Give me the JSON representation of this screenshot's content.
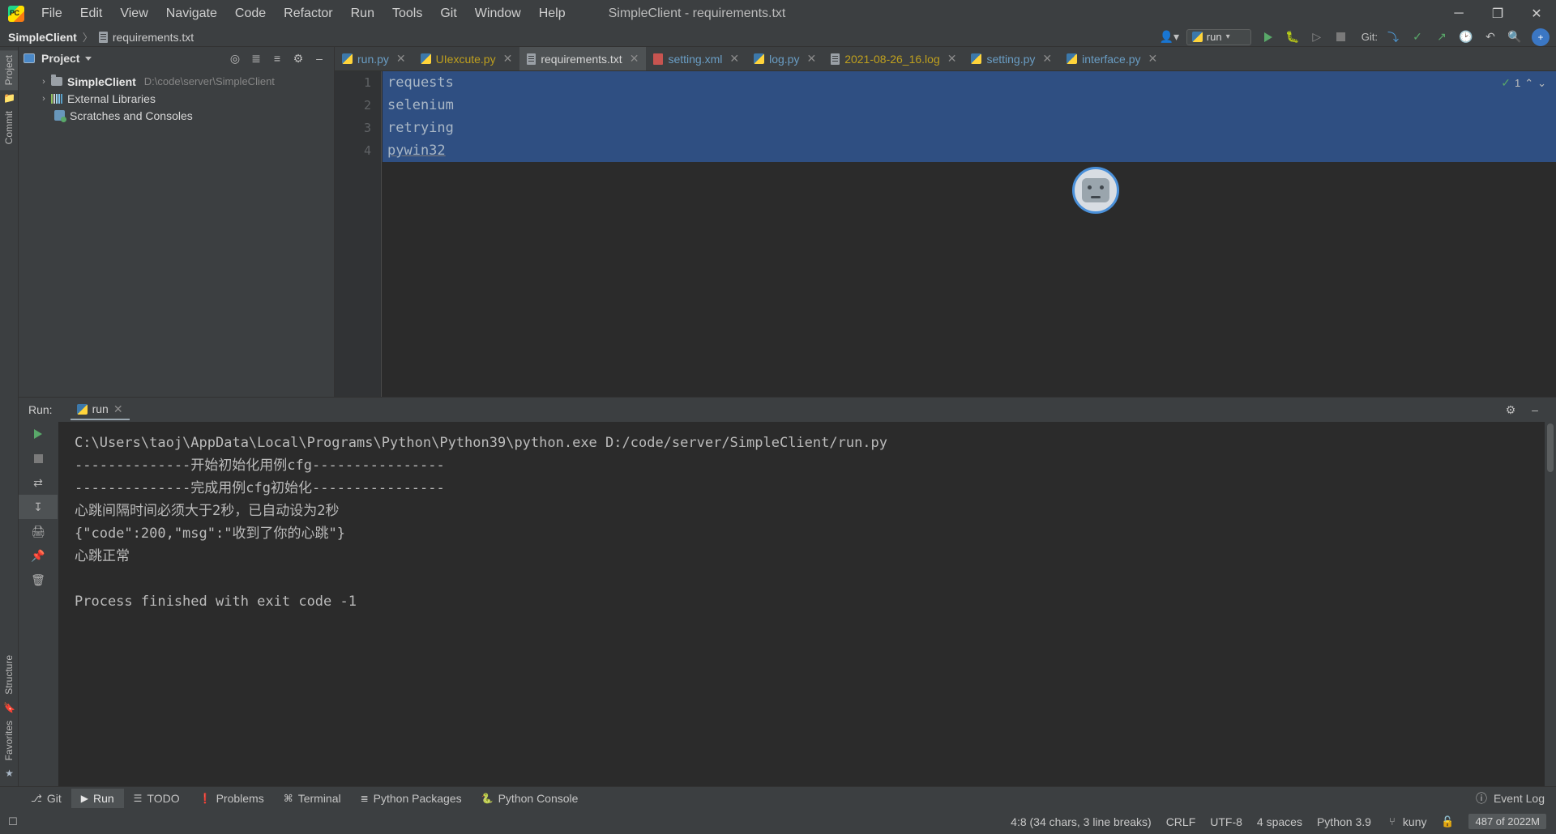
{
  "titlebar": {
    "logo": "pycharm-logo",
    "menus": [
      "File",
      "Edit",
      "View",
      "Navigate",
      "Code",
      "Refactor",
      "Run",
      "Tools",
      "Git",
      "Window",
      "Help"
    ],
    "window_title": "SimpleClient - requirements.txt",
    "minimize": "─",
    "maximize": "❐",
    "close": "✕"
  },
  "navbar": {
    "project_name": "SimpleClient",
    "separator": "〉",
    "file_name": "requirements.txt",
    "profile_icon": "user-icon",
    "run_config_name": "run",
    "run_icon": "run-triangle-icon",
    "debug_icon": "debug-bug-icon",
    "coverage_icon": "run-coverage-icon",
    "stop_icon": "stop-square-icon",
    "git_label": "Git:",
    "git_update_icon": "git-update-icon",
    "git_commit_icon": "git-commit-check-icon",
    "git_push_icon": "git-push-arrow-icon",
    "history_icon": "history-clock-icon",
    "undo_icon": "undo-arrow-icon",
    "search_icon": "search-magnifier-icon",
    "avatar_initial": "+"
  },
  "left_strip": {
    "top_tabs": [
      "Project"
    ],
    "top_icon": "folder-icon",
    "commit_tab": "Commit",
    "structure_tab": "Structure",
    "favorites_tab": "Favorites",
    "star_icon": "star-icon",
    "bookmark_icon": "bookmark-icon"
  },
  "project_panel": {
    "title": "Project",
    "window_icon": "project-window-icon",
    "caret": "chevron-down-icon",
    "tools": [
      "locate-target-icon",
      "expand-all-icon",
      "collapse-all-icon",
      "settings-gear-icon",
      "hide-minus-icon"
    ],
    "tree": [
      {
        "arrow": "›",
        "icon": "folder-icon",
        "name": "SimpleClient",
        "path": "D:\\code\\server\\SimpleClient",
        "bold": true
      },
      {
        "arrow": "›",
        "icon": "libraries-icon",
        "name": "External Libraries",
        "path": "",
        "bold": false
      },
      {
        "arrow": "",
        "icon": "scratches-icon",
        "name": "Scratches and Consoles",
        "path": "",
        "bold": false
      }
    ]
  },
  "editor_tabs": [
    {
      "label": "run.py",
      "icon": "python-file-icon",
      "color": "blue",
      "active": false,
      "close": "✕"
    },
    {
      "label": "UIexcute.py",
      "icon": "python-file-icon",
      "color": "yellow",
      "active": false,
      "close": "✕"
    },
    {
      "label": "requirements.txt",
      "icon": "text-file-icon",
      "color": "white",
      "active": true,
      "close": "✕"
    },
    {
      "label": "setting.xml",
      "icon": "xml-file-icon",
      "color": "blue",
      "active": false,
      "close": "✕"
    },
    {
      "label": "log.py",
      "icon": "python-file-icon",
      "color": "blue",
      "active": false,
      "close": "✕"
    },
    {
      "label": "2021-08-26_16.log",
      "icon": "text-file-icon",
      "color": "yellow",
      "active": false,
      "close": "✕"
    },
    {
      "label": "setting.py",
      "icon": "python-file-icon",
      "color": "blue",
      "active": false,
      "close": "✕"
    },
    {
      "label": "interface.py",
      "icon": "python-file-icon",
      "color": "blue",
      "active": false,
      "close": "✕"
    }
  ],
  "editor": {
    "line_numbers": [
      "1",
      "2",
      "3",
      "4"
    ],
    "lines": [
      "requests",
      "selenium",
      "retrying",
      "pywin32"
    ],
    "inspection_count": "1",
    "inspection_check": "✓",
    "inspection_up": "⌃",
    "inspection_down": "⌄",
    "avatar": "user-avatar-icon"
  },
  "run_panel": {
    "label": "Run:",
    "tab_name": "run",
    "tab_icon": "python-icon",
    "tab_close": "✕",
    "settings_icon": "settings-gear-icon",
    "hide_icon": "hide-minus-icon",
    "toolbar": [
      "rerun-play-icon",
      "stop-square-icon",
      "up-arrow-icon",
      "down-arrow-icon",
      "soft-wrap-icon",
      "print-icon",
      "scroll-to-end-icon",
      "pin-icon",
      "trash-icon"
    ],
    "console_lines": [
      "C:\\Users\\taoj\\AppData\\Local\\Programs\\Python\\Python39\\python.exe D:/code/server/SimpleClient/run.py",
      "--------------开始初始化用例cfg----------------",
      "--------------完成用例cfg初始化----------------",
      "心跳间隔时间必须大于2秒，已自动设为2秒",
      "{\"code\":200,\"msg\":\"收到了你的心跳\"}",
      "心跳正常",
      "",
      "Process finished with exit code -1"
    ]
  },
  "bottom_bar": {
    "items": [
      {
        "label": "Git",
        "icon": "git-branch-icon",
        "selected": false
      },
      {
        "label": "Run",
        "icon": "run-triangle-icon",
        "selected": true
      },
      {
        "label": "TODO",
        "icon": "todo-list-icon",
        "selected": false
      },
      {
        "label": "Problems",
        "icon": "problems-warning-icon",
        "selected": false
      },
      {
        "label": "Terminal",
        "icon": "terminal-icon",
        "selected": false
      },
      {
        "label": "Python Packages",
        "icon": "packages-icon",
        "selected": false
      },
      {
        "label": "Python Console",
        "icon": "python-icon",
        "selected": false
      }
    ],
    "event_log": "Event Log",
    "event_log_icon": "event-log-icon"
  },
  "status_bar": {
    "layout_icon": "layout-toggle-icon",
    "caret_position": "4:8 (34 chars, 3 line breaks)",
    "line_separator": "CRLF",
    "encoding": "UTF-8",
    "indent": "4 spaces",
    "interpreter": "Python 3.9",
    "branch_icon": "git-branch-icon",
    "branch": "kuny",
    "lock_icon": "lock-icon",
    "memory": "487 of 2022M"
  }
}
